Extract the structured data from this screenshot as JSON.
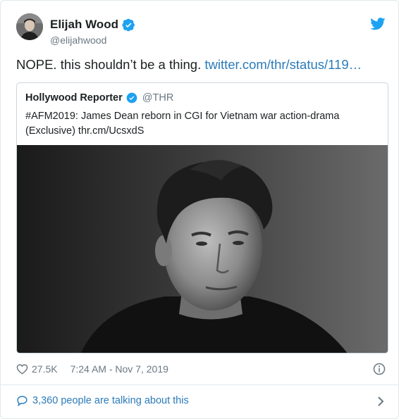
{
  "author": {
    "display_name": "Elijah Wood",
    "handle": "@elijahwood"
  },
  "tweet": {
    "text": "NOPE. this shouldn’t be a thing.",
    "link": "twitter.com/thr/status/119…"
  },
  "quoted": {
    "display_name": "Hollywood Reporter",
    "handle": "@THR",
    "text": "#AFM2019: James Dean reborn in CGI for Vietnam war action-drama (Exclusive) thr.cm/UcsxdS"
  },
  "footer": {
    "likes": "27.5K",
    "timestamp": "7:24 AM - Nov 7, 2019",
    "talking": "3,360 people are talking about this"
  },
  "icons": {
    "verified": "verified-badge-icon",
    "twitter": "twitter-bird-icon",
    "like": "heart-icon",
    "info": "info-icon",
    "talking": "speech-bubble-icon",
    "more": "chevron-right-icon"
  },
  "colors": {
    "brand_blue": "#1da1f2",
    "link_blue": "#2b7bb9",
    "muted_text": "#697882",
    "border": "#e1e8ed"
  }
}
